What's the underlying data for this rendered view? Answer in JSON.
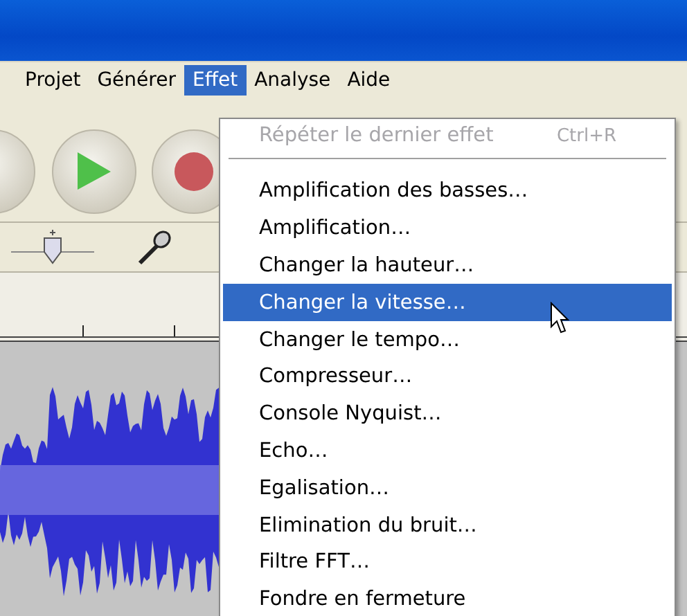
{
  "menu_bar": [
    {
      "label": "Projet",
      "selected": false
    },
    {
      "label": "Générer",
      "selected": false
    },
    {
      "label": "Effet",
      "selected": true
    },
    {
      "label": "Analyse",
      "selected": false
    },
    {
      "label": "Aide",
      "selected": false
    }
  ],
  "effect_menu": {
    "items": [
      {
        "kind": "item",
        "label": "Répéter le dernier effet",
        "shortcut": "Ctrl+R",
        "disabled": true,
        "selected": false
      },
      {
        "kind": "separator"
      },
      {
        "kind": "item",
        "label": "Amplification des basses…",
        "disabled": false,
        "selected": false
      },
      {
        "kind": "item",
        "label": "Amplification…",
        "disabled": false,
        "selected": false
      },
      {
        "kind": "item",
        "label": "Changer la hauteur…",
        "disabled": false,
        "selected": false
      },
      {
        "kind": "item",
        "label": "Changer la vitesse…",
        "disabled": false,
        "selected": true
      },
      {
        "kind": "item",
        "label": "Changer le tempo…",
        "disabled": false,
        "selected": false
      },
      {
        "kind": "item",
        "label": "Compresseur…",
        "disabled": false,
        "selected": false
      },
      {
        "kind": "item",
        "label": "Console Nyquist…",
        "disabled": false,
        "selected": false
      },
      {
        "kind": "item",
        "label": "Echo…",
        "disabled": false,
        "selected": false
      },
      {
        "kind": "item",
        "label": "Egalisation…",
        "disabled": false,
        "selected": false
      },
      {
        "kind": "item",
        "label": "Elimination du bruit…",
        "disabled": false,
        "selected": false
      },
      {
        "kind": "item",
        "label": "Filtre FFT…",
        "disabled": false,
        "selected": false
      },
      {
        "kind": "item",
        "label": "Fondre en fermeture",
        "disabled": false,
        "selected": false
      }
    ]
  }
}
